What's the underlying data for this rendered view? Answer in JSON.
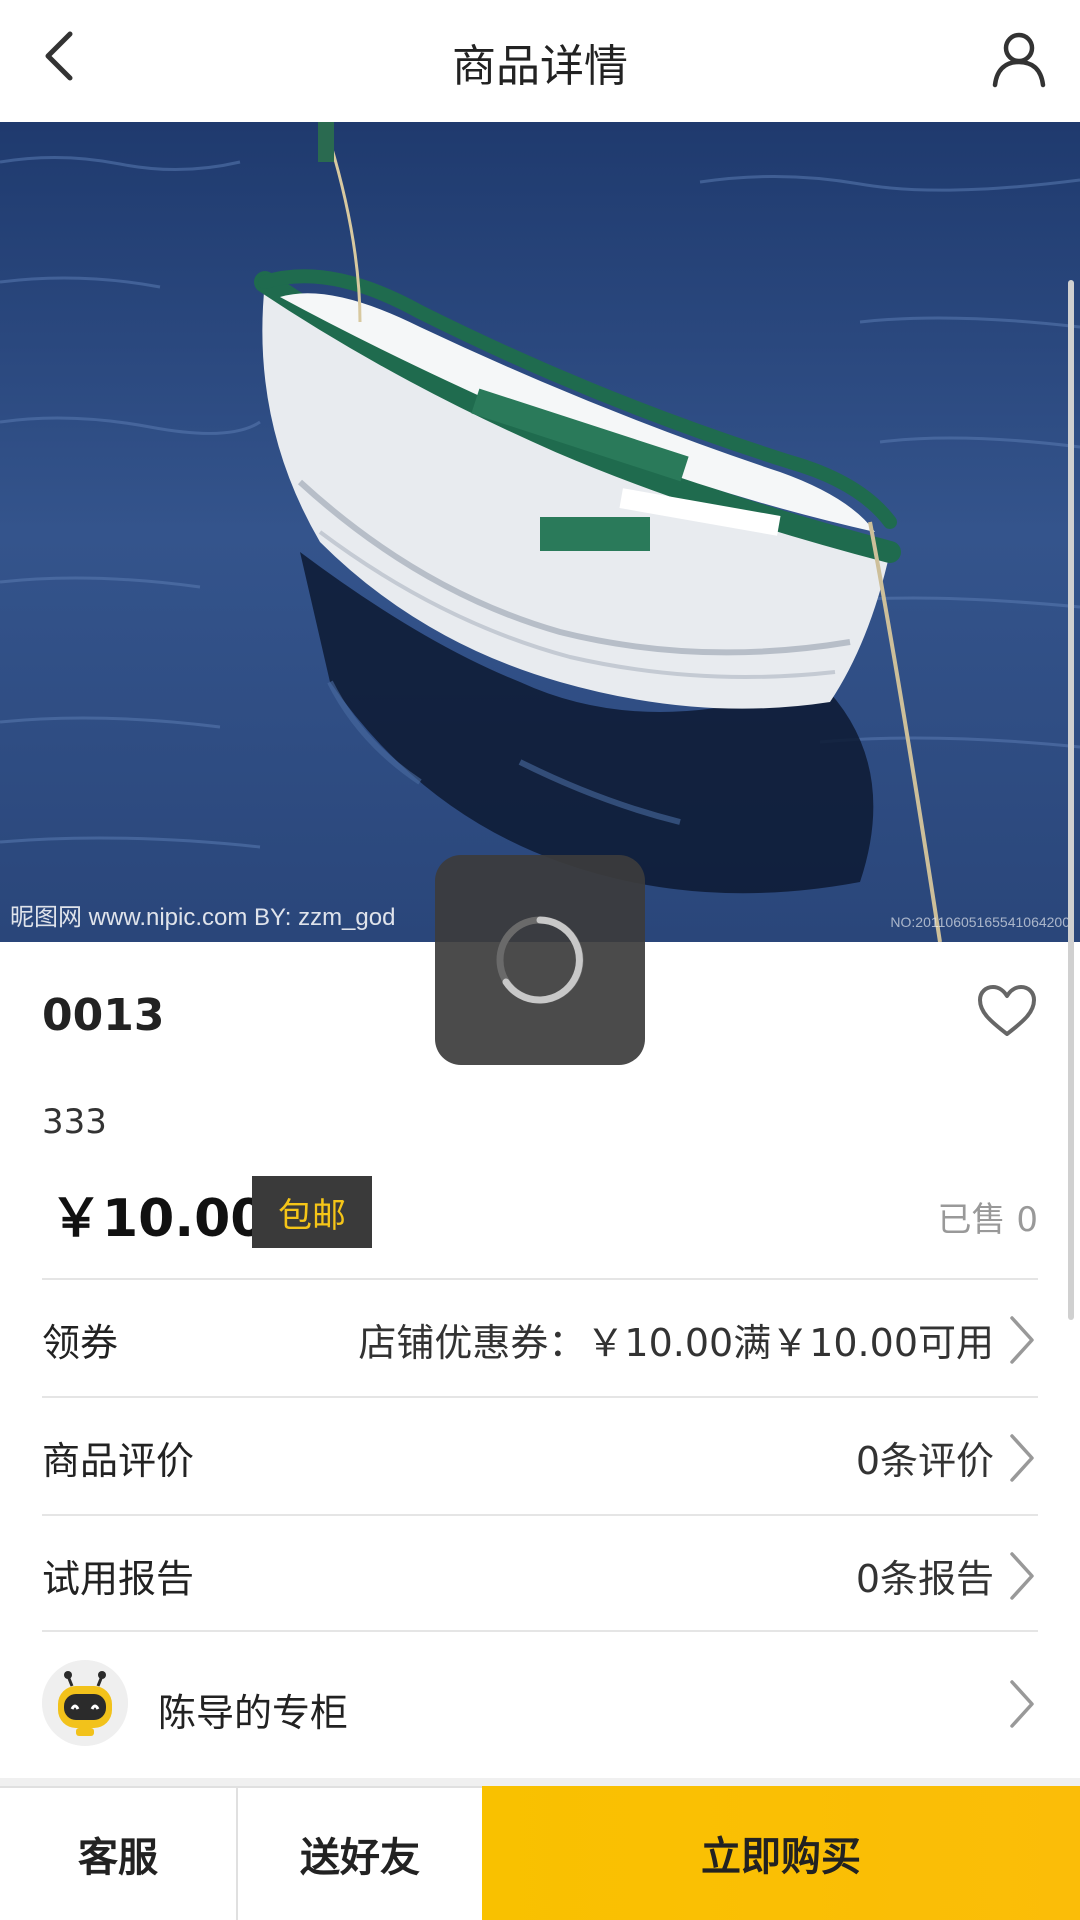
{
  "header": {
    "title": "商品详情",
    "back_icon": "chevron-left-icon",
    "user_icon": "user-icon"
  },
  "product_image": {
    "watermark_left": "昵图网 www.nipic.com   BY: zzm_god",
    "watermark_right": "NO:20110605165541064200"
  },
  "product": {
    "name": "0013",
    "description": "333",
    "price": "￥10.00",
    "shipping_badge": "包邮",
    "sold": "已售 0",
    "favorite_icon": "heart-outline-icon"
  },
  "rows": {
    "coupon": {
      "label": "领券",
      "value": "店铺优惠券：￥10.00满￥10.00可用"
    },
    "reviews": {
      "label": "商品评价",
      "value": "0条评价"
    },
    "trial": {
      "label": "试用报告",
      "value": "0条报告"
    }
  },
  "shop": {
    "name": "陈导的专柜",
    "avatar_icon": "robot-avatar-icon"
  },
  "bottom_bar": {
    "service": "客服",
    "share": "送好友",
    "buy": "立即购买"
  },
  "colors": {
    "accent": "#f9c100",
    "badge_bg": "#3a3a3a",
    "badge_text": "#f5c518",
    "divider": "#e5e5e5"
  }
}
